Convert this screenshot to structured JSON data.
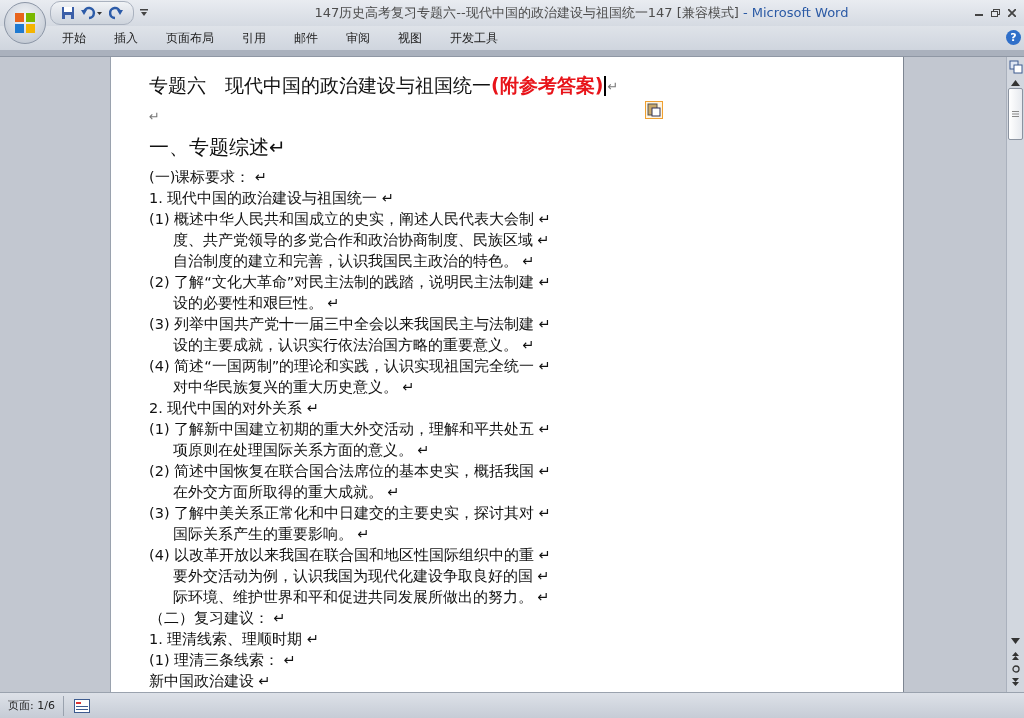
{
  "window": {
    "title": "147历史高考复习专题六--现代中国的政治建设与祖国统一147 [兼容模式]",
    "app": " - Microsoft Word"
  },
  "ribbon_tabs": [
    "开始",
    "插入",
    "页面布局",
    "引用",
    "邮件",
    "审阅",
    "视图",
    "开发工具"
  ],
  "help": "?",
  "document": {
    "title": "专题六　现代中国的政治建设与祖国统一",
    "title_note": "(附参考答案)",
    "title_mark": "↵",
    "blank_mark": "↵",
    "heading": "一、专题综述↵",
    "lines": [
      {
        "kind": "line",
        "text": "(一)课标要求： ↵"
      },
      {
        "kind": "line",
        "text": "1. 现代中国的政治建设与祖国统一 ↵"
      },
      {
        "kind": "line",
        "text": "(1) 概述中华人民共和国成立的史实，阐述人民代表大会制 ↵"
      },
      {
        "kind": "cont",
        "text": "度、共产党领导的多党合作和政治协商制度、民族区域 ↵"
      },
      {
        "kind": "cont",
        "text": "自治制度的建立和完善，认识我国民主政治的特色。 ↵"
      },
      {
        "kind": "line",
        "text": "(2) 了解“文化大革命”对民主法制的践踏，说明民主法制建 ↵"
      },
      {
        "kind": "cont",
        "text": "设的必要性和艰巨性。 ↵"
      },
      {
        "kind": "line",
        "text": "(3) 列举中国共产党十一届三中全会以来我国民主与法制建 ↵"
      },
      {
        "kind": "cont",
        "text": "设的主要成就，认识实行依法治国方略的重要意义。 ↵"
      },
      {
        "kind": "line",
        "text": "(4) 简述“一国两制”的理论和实践，认识实现祖国完全统一 ↵"
      },
      {
        "kind": "cont",
        "text": "对中华民族复兴的重大历史意义。 ↵"
      },
      {
        "kind": "line",
        "text": "2. 现代中国的对外关系 ↵"
      },
      {
        "kind": "line",
        "text": "(1) 了解新中国建立初期的重大外交活动，理解和平共处五 ↵"
      },
      {
        "kind": "cont",
        "text": "项原则在处理国际关系方面的意义。 ↵"
      },
      {
        "kind": "line",
        "text": "(2) 简述中国恢复在联合国合法席位的基本史实，概括我国 ↵"
      },
      {
        "kind": "cont",
        "text": "在外交方面所取得的重大成就。 ↵"
      },
      {
        "kind": "line",
        "text": "(3) 了解中美关系正常化和中日建交的主要史实，探讨其对 ↵"
      },
      {
        "kind": "cont",
        "text": "国际关系产生的重要影响。 ↵"
      },
      {
        "kind": "line",
        "text": "(4) 以改革开放以来我国在联合国和地区性国际组织中的重 ↵"
      },
      {
        "kind": "cont",
        "text": "要外交活动为例，认识我国为现代化建设争取良好的国 ↵"
      },
      {
        "kind": "cont",
        "text": "际环境、维护世界和平和促进共同发展所做出的努力。 ↵"
      },
      {
        "kind": "line",
        "text": "（二）复习建议： ↵"
      },
      {
        "kind": "line",
        "text": "1. 理清线索、理顺时期 ↵"
      },
      {
        "kind": "line",
        "text": "(1) 理清三条线索： ↵"
      },
      {
        "kind": "line",
        "text": "新中国政治建设 ↵"
      }
    ]
  },
  "status_bar": {
    "page": "页面: 1/6"
  }
}
